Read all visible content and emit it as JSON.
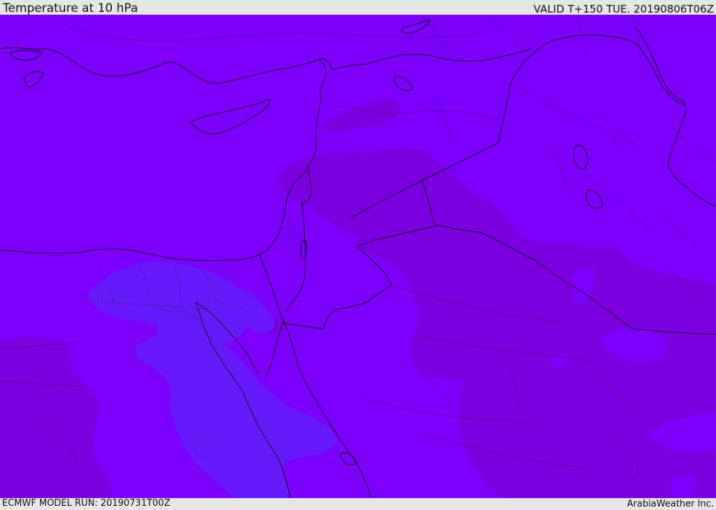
{
  "header": {
    "title": "Temperature at 10 hPa",
    "valid_time": "VALID T+150 TUE. 20190806T06Z"
  },
  "footer": {
    "model_run": "ECMWF MODEL RUN: 20190731T00Z",
    "credit": "ArabiaWeather Inc."
  },
  "map": {
    "field": "Temperature at 10 hPa",
    "colors": {
      "background_violet": "#7d00fd",
      "warmer_purple": "#7a00e0",
      "cooler_blue_violet": "#6619fb",
      "coastline": "#111111",
      "border": "#111111"
    },
    "labels_shown": false
  }
}
